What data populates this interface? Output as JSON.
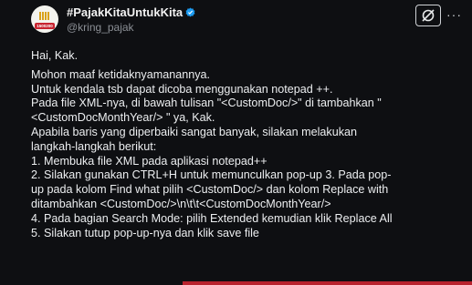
{
  "tweet": {
    "display_name": "#PajakKitaUntukKita",
    "handle": "@kring_pajak",
    "avatar_text": "1500200",
    "greeting": "Hai, Kak.",
    "lines": [
      "Mohon maaf ketidaknyamanannya.",
      "Untuk kendala tsb dapat dicoba menggunakan notepad ++.",
      "Pada file XML-nya, di bawah tulisan \"<CustomDoc/>\" di tambahkan \"",
      "<CustomDocMonthYear/> \" ya, Kak.",
      "Apabila baris yang diperbaiki sangat banyak, silakan melakukan",
      "langkah-langkah berikut:",
      "1. Membuka file XML pada aplikasi notepad++",
      "2. Silakan gunakan CTRL+H untuk memunculkan pop-up 3. Pada pop-",
      "up pada kolom Find what pilih <CustomDoc/> dan kolom Replace with",
      "ditambahkan <CustomDoc/>\\n\\t\\t<CustomDocMonthYear/>",
      "4. Pada bagian Search Mode: pilih Extended kemudian klik Replace All",
      "5. Silakan tutup pop-up-nya dan klik save file"
    ]
  },
  "icons": {
    "verified": "verified-badge-icon",
    "grok": "grok-icon",
    "more": "more-icon"
  },
  "colors": {
    "background": "#0e0f12",
    "verified": "#1d9bf0",
    "accent": "#b8232e"
  }
}
